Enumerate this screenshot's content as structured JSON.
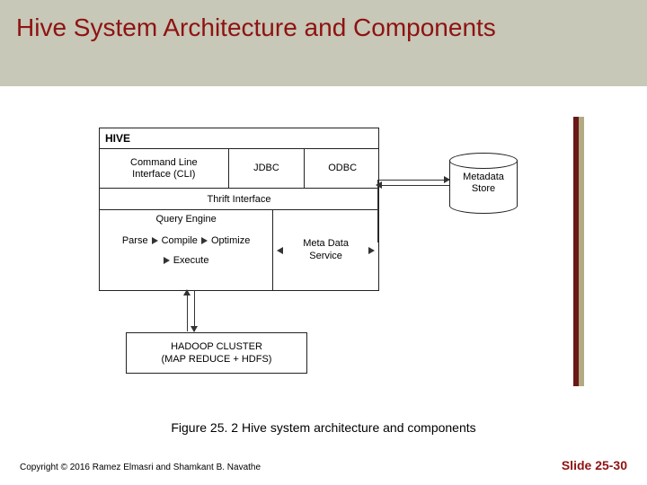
{
  "title": "Hive System Architecture and Components",
  "hive": {
    "label": "HIVE",
    "interfaces": {
      "cli": "Command Line\nInterface (CLI)",
      "jdbc": "JDBC",
      "odbc": "ODBC"
    },
    "thrift": "Thrift Interface",
    "query": {
      "title": "Query Engine",
      "parse": "Parse",
      "compile": "Compile",
      "optimize": "Optimize",
      "execute": "Execute"
    },
    "metaservice": "Meta Data\nService"
  },
  "hadoop": {
    "line1": "HADOOP CLUSTER",
    "line2": "(MAP REDUCE + HDFS)"
  },
  "metadata_store": "Metadata\nStore",
  "caption": "Figure 25. 2 Hive system architecture and components",
  "footer": {
    "copyright": "Copyright © 2016 Ramez Elmasri and Shamkant B. Navathe",
    "slide": "Slide 25-30"
  }
}
